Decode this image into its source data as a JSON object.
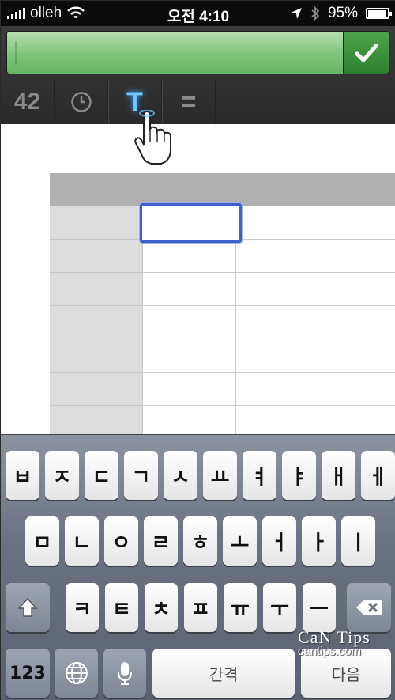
{
  "status_bar": {
    "carrier": "olleh",
    "time": "오전 4:10",
    "battery_percent": "95%",
    "battery_level": 0.95
  },
  "toolbar": {
    "number_label": "42",
    "text_label": "T",
    "formula_label": "=",
    "active_tool": "text"
  },
  "colors": {
    "entry_bar": "#7cc57a",
    "accent_blue": "#3c62c8",
    "text_tool_glow": "#6ec8ff"
  },
  "spreadsheet": {
    "header_row_visible": true,
    "rows_visible": 7,
    "columns_visible": 3
  },
  "keyboard": {
    "row1": [
      "ㅂ",
      "ㅈ",
      "ㄷ",
      "ㄱ",
      "ㅅ",
      "ㅛ",
      "ㅕ",
      "ㅑ",
      "ㅐ",
      "ㅔ"
    ],
    "row2": [
      "ㅁ",
      "ㄴ",
      "ㅇ",
      "ㄹ",
      "ㅎ",
      "ㅗ",
      "ㅓ",
      "ㅏ",
      "ㅣ"
    ],
    "row3": [
      "ㅋ",
      "ㅌ",
      "ㅊ",
      "ㅍ",
      "ㅠ",
      "ㅜ",
      "ㅡ"
    ],
    "numbers_label": "123",
    "space_label": "간격",
    "done_label": "다음"
  },
  "icons": {
    "check": "check-icon",
    "clock": "clock-icon",
    "shift": "shift-icon",
    "delete": "delete-icon",
    "globe": "globe-icon",
    "mic": "microphone-icon",
    "hand": "hand-pointer-icon"
  },
  "watermark": {
    "title": "CaN Tips",
    "url": "cantips.com"
  }
}
